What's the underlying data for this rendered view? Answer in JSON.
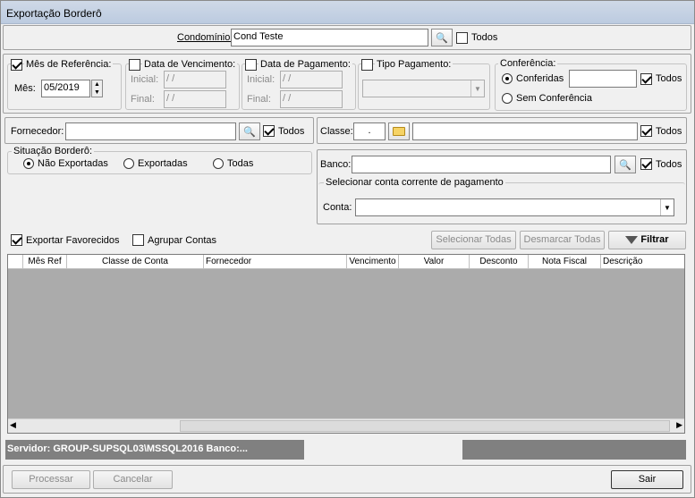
{
  "window": {
    "title": "Exportação Borderô"
  },
  "condominio": {
    "label": "Condomínio:",
    "value": "Cond Teste",
    "todos_label": "Todos"
  },
  "mes_referencia": {
    "label": "Mês de Referência:",
    "mes_label": "Mês:",
    "value": "05/2019"
  },
  "data_vencimento": {
    "label": "Data de Vencimento:",
    "inicial_label": "Inicial:",
    "final_label": "Final:",
    "inicial_value": " /  /",
    "final_value": " /  /"
  },
  "data_pagamento": {
    "label": "Data de Pagamento:",
    "inicial_label": "Inicial:",
    "final_label": "Final:",
    "inicial_value": " /  /",
    "final_value": " /  /"
  },
  "tipo_pagamento": {
    "label": "Tipo Pagamento:"
  },
  "conferencia": {
    "label": "Conferência:",
    "conferidas_label": "Conferidas",
    "sem_label": "Sem Conferência",
    "todos_label": "Todos"
  },
  "fornecedor": {
    "label": "Fornecedor:",
    "value": "",
    "todos_label": "Todos"
  },
  "classe": {
    "label": "Classe:",
    "code": ".",
    "todos_label": "Todos"
  },
  "situacao": {
    "label": "Situação Borderô:",
    "options": [
      "Não Exportadas",
      "Exportadas",
      "Todas"
    ]
  },
  "banco": {
    "label": "Banco:",
    "todos_label": "Todos"
  },
  "conta_corrente": {
    "label": "Selecionar conta corrente de pagamento",
    "conta_label": "Conta:"
  },
  "options": {
    "exportar_favorecidos": "Exportar Favorecidos",
    "agrupar_contas": "Agrupar Contas"
  },
  "buttons": {
    "selecionar_todas": "Selecionar Todas",
    "desmarcar_todas": "Desmarcar Todas",
    "filtrar": "Filtrar",
    "processar": "Processar",
    "cancelar": "Cancelar",
    "sair": "Sair"
  },
  "grid": {
    "columns": [
      "",
      "Mês Ref",
      "Classe de Conta",
      "Fornecedor",
      "Vencimento",
      "Valor",
      "Desconto",
      "Nota Fiscal",
      "Descrição"
    ]
  },
  "status": {
    "server": "Servidor: GROUP-SUPSQL03\\MSSQL2016 Banco:..."
  }
}
